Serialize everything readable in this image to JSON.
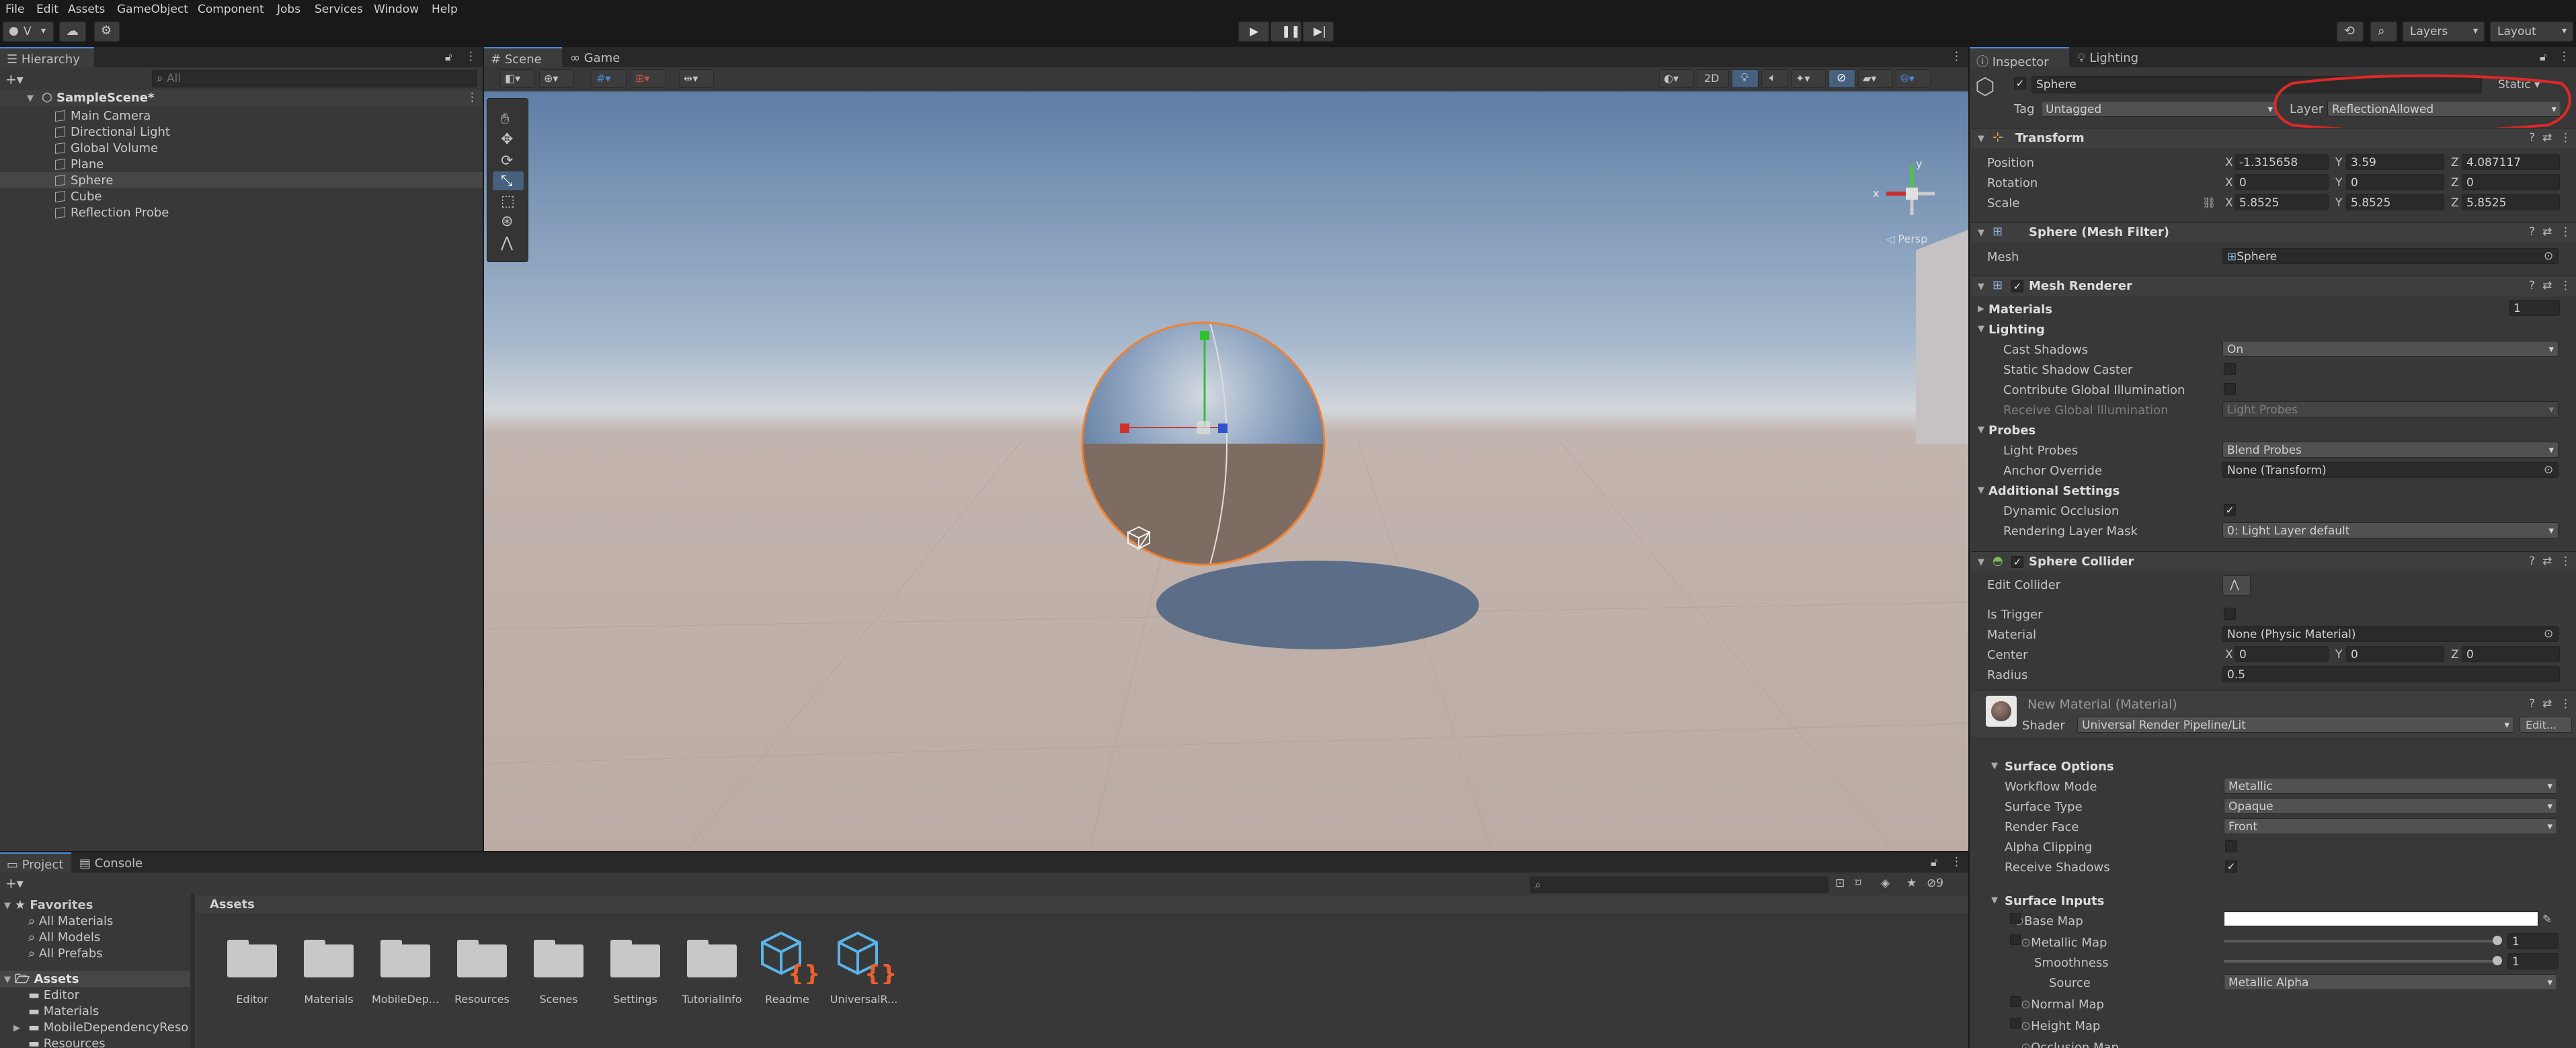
{
  "menu": [
    "File",
    "Edit",
    "Assets",
    "GameObject",
    "Component",
    "Jobs",
    "Services",
    "Window",
    "Help"
  ],
  "toolbar": {
    "account_label": "V",
    "layers_label": "Layers",
    "layout_label": "Layout"
  },
  "hierarchy": {
    "tab": "Hierarchy",
    "search_placeholder": "All",
    "scene": "SampleScene*",
    "items": [
      "Main Camera",
      "Directional Light",
      "Global Volume",
      "Plane",
      "Sphere",
      "Cube",
      "Reflection Probe"
    ]
  },
  "scene_view": {
    "tabs": [
      "Scene",
      "Game"
    ],
    "toggle_2d": "2D",
    "persp_label": "Persp",
    "axis_x": "x",
    "axis_y": "y"
  },
  "inspector": {
    "tabs": [
      "Inspector",
      "Lighting"
    ],
    "object_name": "Sphere",
    "static_label": "Static",
    "tag_label": "Tag",
    "tag_value": "Untagged",
    "layer_label": "Layer",
    "layer_value": "ReflectionAllowed",
    "transform": {
      "title": "Transform",
      "position_label": "Position",
      "px": "-1.315658",
      "py": "3.59",
      "pz": "4.087117",
      "rotation_label": "Rotation",
      "rx": "0",
      "ry": "0",
      "rz": "0",
      "scale_label": "Scale",
      "sx": "5.8525",
      "sy": "5.8525",
      "sz": "5.8525"
    },
    "mesh_filter": {
      "title": "Sphere (Mesh Filter)",
      "mesh_label": "Mesh",
      "mesh_value": "Sphere"
    },
    "mesh_renderer": {
      "title": "Mesh Renderer",
      "materials_label": "Materials",
      "materials_count": "1",
      "lighting_label": "Lighting",
      "cast_shadows_label": "Cast Shadows",
      "cast_shadows_value": "On",
      "static_caster_label": "Static Shadow Caster",
      "contribute_gi_label": "Contribute Global Illumination",
      "receive_gi_label": "Receive Global Illumination",
      "receive_gi_value": "Light Probes",
      "probes_label": "Probes",
      "light_probes_label": "Light Probes",
      "light_probes_value": "Blend Probes",
      "anchor_label": "Anchor Override",
      "anchor_value": "None (Transform)",
      "additional_label": "Additional Settings",
      "dynamic_occlusion_label": "Dynamic Occlusion",
      "layer_mask_label": "Rendering Layer Mask",
      "layer_mask_value": "0: Light Layer default"
    },
    "sphere_collider": {
      "title": "Sphere Collider",
      "edit_label": "Edit Collider",
      "trigger_label": "Is Trigger",
      "material_label": "Material",
      "material_value": "None (Physic Material)",
      "center_label": "Center",
      "cx": "0",
      "cy": "0",
      "cz": "0",
      "radius_label": "Radius",
      "radius_value": "0.5"
    },
    "material": {
      "title": "New Material (Material)",
      "shader_label": "Shader",
      "shader_value": "Universal Render Pipeline/Lit",
      "edit_label": "Edit...",
      "surface_options": "Surface Options",
      "workflow_label": "Workflow Mode",
      "workflow_value": "Metallic",
      "surface_type_label": "Surface Type",
      "surface_type_value": "Opaque",
      "render_face_label": "Render Face",
      "render_face_value": "Front",
      "alpha_clip_label": "Alpha Clipping",
      "receive_shadows_label": "Receive Shadows",
      "surface_inputs": "Surface Inputs",
      "base_map_label": "Base Map",
      "metallic_map_label": "Metallic Map",
      "metallic_value": "1",
      "smoothness_label": "Smoothness",
      "smoothness_value": "1",
      "source_label": "Source",
      "source_value": "Metallic Alpha",
      "normal_map_label": "Normal Map",
      "height_map_label": "Height Map",
      "occlusion_map_label": "Occlusion Map"
    }
  },
  "project": {
    "tabs": [
      "Project",
      "Console"
    ],
    "favorites_label": "Favorites",
    "favorites": [
      "All Materials",
      "All Models",
      "All Prefabs"
    ],
    "assets_label": "Assets",
    "tree": [
      "Editor",
      "Materials",
      "MobileDependencyReso",
      "Resources"
    ],
    "breadcrumb": "Assets",
    "hidden_count": "9",
    "folders": [
      "Editor",
      "Materials",
      "MobileDep...",
      "Resources",
      "Scenes",
      "Settings",
      "TutorialInfo"
    ],
    "files": [
      "Readme",
      "UniversalR..."
    ]
  },
  "colors": {
    "accent": "#4a8ad8",
    "highlight": "#e02828",
    "selection": "#464646"
  }
}
